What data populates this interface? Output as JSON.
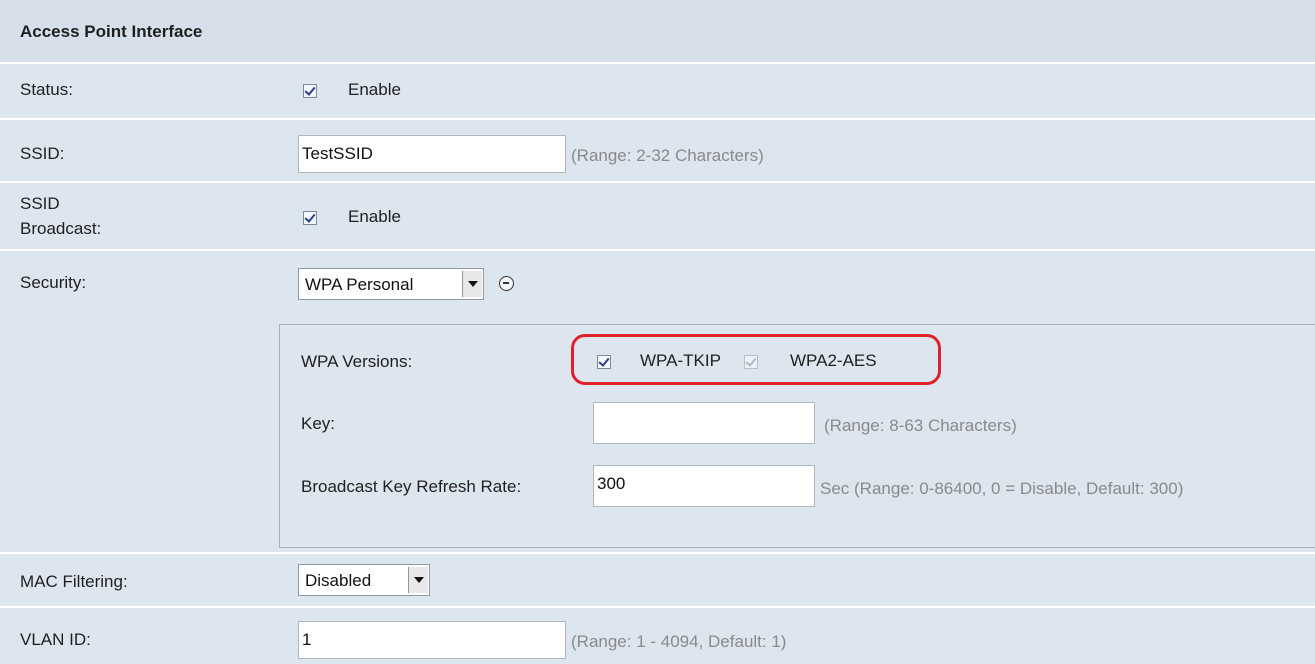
{
  "section_title": "Access Point Interface",
  "status": {
    "label": "Status:",
    "checked": true,
    "option_label": "Enable"
  },
  "ssid": {
    "label": "SSID:",
    "value": "TestSSID",
    "hint": "(Range: 2-32 Characters)"
  },
  "ssid_broadcast": {
    "label_line1": "SSID",
    "label_line2": "Broadcast:",
    "checked": true,
    "option_label": "Enable"
  },
  "security": {
    "label": "Security:",
    "selected": "WPA Personal"
  },
  "wpa": {
    "versions_label": "WPA Versions:",
    "tkip": {
      "label": "WPA-TKIP",
      "checked": true
    },
    "aes": {
      "label": "WPA2-AES",
      "checked": true,
      "disabled": true
    },
    "key": {
      "label": "Key:",
      "value": "",
      "hint": "(Range: 8-63 Characters)"
    },
    "refresh": {
      "label": "Broadcast Key Refresh Rate:",
      "value": "300",
      "hint": "Sec (Range: 0-86400, 0 = Disable, Default: 300)"
    }
  },
  "mac_filtering": {
    "label": "MAC Filtering:",
    "selected": "Disabled"
  },
  "vlan": {
    "label": "VLAN ID:",
    "value": "1",
    "hint": "(Range: 1 - 4094, Default: 1)"
  },
  "colors": {
    "panel_bg": "#dde5ef",
    "highlight": "#e0202a",
    "hint_text": "#8a8a8a"
  }
}
